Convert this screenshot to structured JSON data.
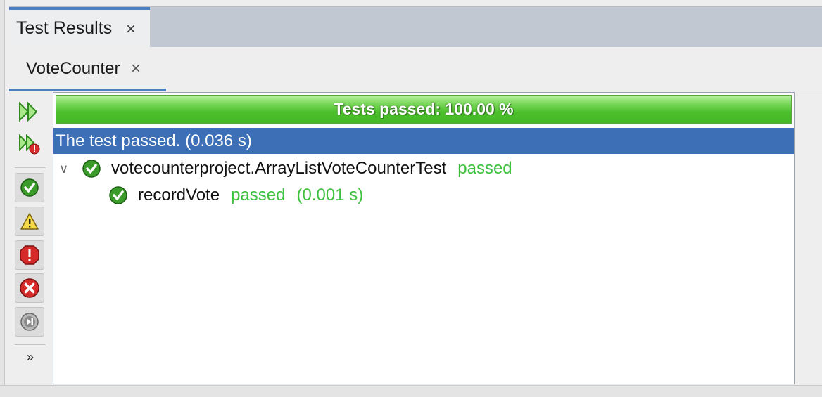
{
  "tabs": {
    "main_label": "Test Results",
    "close_glyph": "×"
  },
  "subtab": {
    "label": "VoteCounter",
    "close_glyph": "×"
  },
  "toolbar": {
    "buttons": [
      "rerun-all-icon",
      "rerun-failed-icon",
      "show-passed-icon",
      "show-warnings-icon",
      "show-failures-icon",
      "show-errors-icon",
      "show-skipped-icon"
    ],
    "more_label": "»"
  },
  "progress": {
    "label": "Tests passed: 100.00 %",
    "value_percent": 100
  },
  "status": {
    "message": "The test passed. (0.036 s)"
  },
  "tree": {
    "suite": {
      "chevron": "∨",
      "name": "votecounterproject.ArrayListVoteCounterTest",
      "result": "passed"
    },
    "test": {
      "name": "recordVote",
      "result": "passed",
      "time": "(0.001 s)"
    }
  },
  "colors": {
    "accent": "#3d6fb6",
    "pass_green": "#3ec13e",
    "progress_green": "#4cbf2c"
  }
}
